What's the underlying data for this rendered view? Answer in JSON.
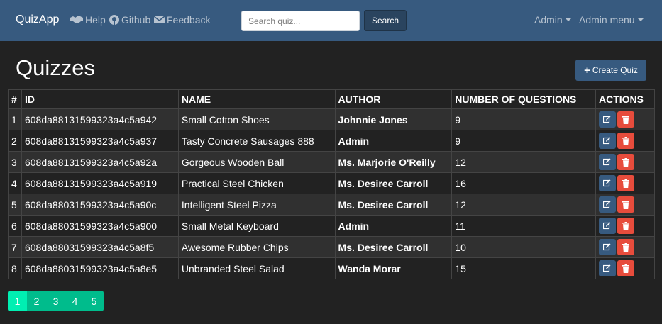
{
  "navbar": {
    "brand": "QuizApp",
    "links": [
      {
        "label": "Help",
        "icon": "handshake-icon"
      },
      {
        "label": "Github",
        "icon": "github-icon"
      },
      {
        "label": "Feedback",
        "icon": "envelope-icon"
      }
    ],
    "search": {
      "placeholder": "Search quiz...",
      "value": "",
      "button_label": "Search"
    },
    "dropdowns": [
      "Admin",
      "Admin menu"
    ]
  },
  "page": {
    "title": "Quizzes",
    "create_button_label": "Create Quiz"
  },
  "table": {
    "headers": [
      "#",
      "ID",
      "NAME",
      "AUTHOR",
      "NUMBER OF QUESTIONS",
      "ACTIONS"
    ],
    "rows": [
      {
        "num": "1",
        "id": "608da88131599323a4c5a942",
        "name": "Small Cotton Shoes",
        "author": "Johnnie Jones",
        "questions": "9"
      },
      {
        "num": "2",
        "id": "608da88131599323a4c5a937",
        "name": "Tasty Concrete Sausages 888",
        "author": "Admin",
        "questions": "9"
      },
      {
        "num": "3",
        "id": "608da88131599323a4c5a92a",
        "name": "Gorgeous Wooden Ball",
        "author": "Ms. Marjorie O'Reilly",
        "questions": "12"
      },
      {
        "num": "4",
        "id": "608da88131599323a4c5a919",
        "name": "Practical Steel Chicken",
        "author": "Ms. Desiree Carroll",
        "questions": "16"
      },
      {
        "num": "5",
        "id": "608da88031599323a4c5a90c",
        "name": "Intelligent Steel Pizza",
        "author": "Ms. Desiree Carroll",
        "questions": "12"
      },
      {
        "num": "6",
        "id": "608da88031599323a4c5a900",
        "name": "Small Metal Keyboard",
        "author": "Admin",
        "questions": "11"
      },
      {
        "num": "7",
        "id": "608da88031599323a4c5a8f5",
        "name": "Awesome Rubber Chips",
        "author": "Ms. Desiree Carroll",
        "questions": "10"
      },
      {
        "num": "8",
        "id": "608da88031599323a4c5a8e5",
        "name": "Unbranded Steel Salad",
        "author": "Wanda Morar",
        "questions": "15"
      }
    ]
  },
  "pagination": {
    "pages": [
      "1",
      "2",
      "3",
      "4",
      "5"
    ],
    "current": "1"
  },
  "colors": {
    "navbar": "#375a7f",
    "background": "#222222",
    "edit": "#375a7f",
    "delete": "#e74c3c",
    "pagination": "#00bc8c",
    "pagination_active": "#00efb2"
  }
}
